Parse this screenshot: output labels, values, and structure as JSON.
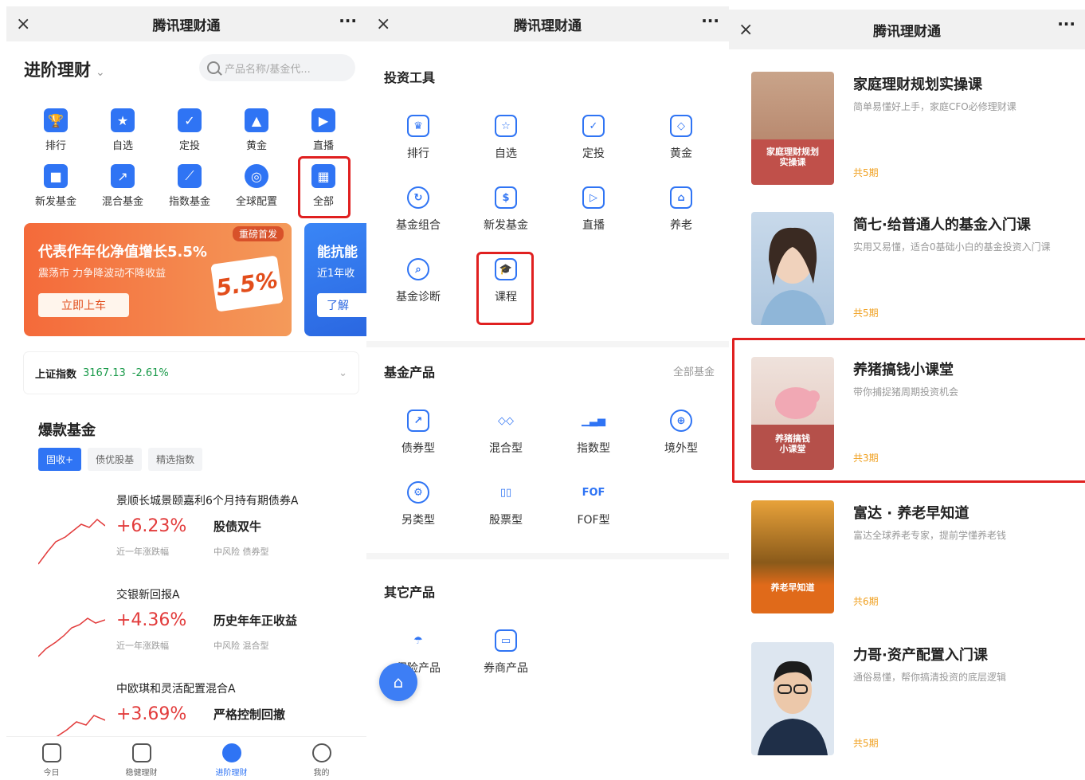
{
  "panel1": {
    "topbar": {
      "title": "腾讯理财通",
      "close": "×",
      "more": "···"
    },
    "brand": "进阶理财",
    "brand_chevron": "⌄",
    "search_placeholder": "产品名称/基金代...",
    "quick": [
      {
        "label": "排行",
        "icon": "trophy-icon"
      },
      {
        "label": "自选",
        "icon": "star-icon"
      },
      {
        "label": "定投",
        "icon": "calendar-icon"
      },
      {
        "label": "黄金",
        "icon": "gold-icon"
      },
      {
        "label": "直播",
        "icon": "live-icon"
      },
      {
        "label": "新发基金",
        "icon": "bag-icon"
      },
      {
        "label": "混合基金",
        "icon": "mixed-chart-icon"
      },
      {
        "label": "指数基金",
        "icon": "index-chart-icon"
      },
      {
        "label": "全球配置",
        "icon": "globe-icon"
      },
      {
        "label": "全部",
        "icon": "grid-icon"
      }
    ],
    "banner": {
      "tag": "重磅首发",
      "headline": "代表作年化净值增长5.5%",
      "sub": "震荡市 力争降波动不降收益",
      "button": "立即上车",
      "percent": "5.5%"
    },
    "banner2": {
      "headline": "能抗能",
      "sub": "近1年收",
      "button": "了解"
    },
    "index": {
      "name": "上证指数",
      "value": "3167.13",
      "change": "-2.61%"
    },
    "hot": {
      "title": "爆款基金",
      "tabs": [
        "固收+",
        "债优股基",
        "精选指数"
      ],
      "funds": [
        {
          "name": "景顺长城景颐嘉利6个月持有期债券A",
          "rate": "+6.23%",
          "rate_label": "近一年涨跌幅",
          "tagline": "股债双牛",
          "meta": "中风险  债券型"
        },
        {
          "name": "交银新回报A",
          "rate": "+4.36%",
          "rate_label": "近一年涨跌幅",
          "tagline": "历史年年正收益",
          "meta": "中风险  混合型"
        },
        {
          "name": "中欧琪和灵活配置混合A",
          "rate": "+3.69%",
          "rate_label": "",
          "tagline": "严格控制回撤",
          "meta": ""
        }
      ]
    },
    "nav": [
      {
        "label": "今日"
      },
      {
        "label": "稳健理财"
      },
      {
        "label": "进阶理财"
      },
      {
        "label": "我的"
      }
    ]
  },
  "panel2": {
    "topbar": {
      "title": "腾讯理财通",
      "close": "×",
      "more": "···"
    },
    "tools": {
      "title": "投资工具",
      "items": [
        "排行",
        "自选",
        "定投",
        "黄金",
        "基金组合",
        "新发基金",
        "直播",
        "养老",
        "基金诊断",
        "课程"
      ]
    },
    "funds": {
      "title": "基金产品",
      "more": "全部基金",
      "items": [
        "债券型",
        "混合型",
        "指数型",
        "境外型",
        "另类型",
        "股票型",
        "FOF型"
      ]
    },
    "others": {
      "title": "其它产品",
      "items": [
        "保险产品",
        "券商产品"
      ]
    }
  },
  "panel3": {
    "topbar": {
      "title": "腾讯理财通",
      "close": "×",
      "more": "···"
    },
    "courses": [
      {
        "title": "家庭理财规划实操课",
        "sub": "简单易懂好上手，家庭CFO必修理财课",
        "episodes": "共5期",
        "thumb_text": "家庭理财规划\n实操课"
      },
      {
        "title": "简七·给普通人的基金入门课",
        "sub": "实用又易懂，适合0基础小白的基金投资入门课",
        "episodes": "共5期",
        "thumb_text": ""
      },
      {
        "title": "养猪搞钱小课堂",
        "sub": "带你捕捉猪周期投资机会",
        "episodes": "共3期",
        "thumb_text": "养猪搞钱\n小课堂"
      },
      {
        "title": "富达 · 养老早知道",
        "sub": "富达全球养老专家，提前学懂养老钱",
        "episodes": "共6期",
        "thumb_text": "养老早知道"
      },
      {
        "title": "力哥·资产配置入门课",
        "sub": "通俗易懂，帮你搞清投资的底层逻辑",
        "episodes": "共5期",
        "thumb_text": ""
      }
    ]
  },
  "colors": {
    "accent": "#2f74f4",
    "highlight": "#e02020",
    "up": "#e23b3b",
    "down": "#1a9a4a",
    "episode": "#f0a020"
  }
}
